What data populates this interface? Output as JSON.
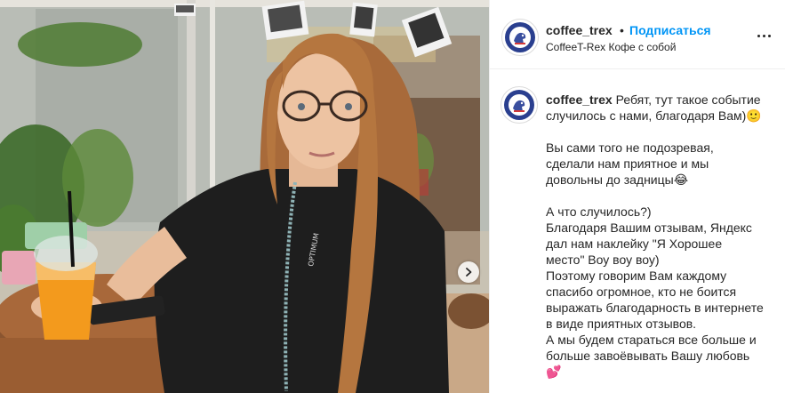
{
  "header": {
    "username": "coffee_trex",
    "dot": "•",
    "follow_label": "Подписаться",
    "location": "CoffeeT-Rex Кофе с собой"
  },
  "caption": {
    "username": "coffee_trex",
    "first_line": "Ребят, тут такое событие случилось с нами, благодаря Вам)🙂",
    "paragraph_2": "Вы сами того не подозревая, сделали нам приятное и мы довольны до задницы😂",
    "paragraph_3_line_1": "А что случилось?)",
    "paragraph_3_line_2": "Благодаря Вашим отзывам, Яндекс дал нам наклейку \"Я Хорошее место\" Воу воу воу)",
    "paragraph_3_line_3": "Поэтому говорим Вам каждому спасибо огромное, кто не боится выражать благодарность в интернете в виде приятных отзывов.",
    "paragraph_3_line_4": "А мы будем стараться все больше и больше завоёвывать Вашу любовь",
    "trailing_emoji": "💕"
  },
  "photo": {
    "shirt_print": "OPTIMUM",
    "next_icon": "chevron-right-icon"
  },
  "colors": {
    "accent": "#0095f6",
    "text": "#262626",
    "border": "#efefef",
    "avatar_blue": "#2a3f8f"
  },
  "icons": [
    "more-options-icon",
    "chevron-right-icon",
    "coffee-trex-logo"
  ]
}
